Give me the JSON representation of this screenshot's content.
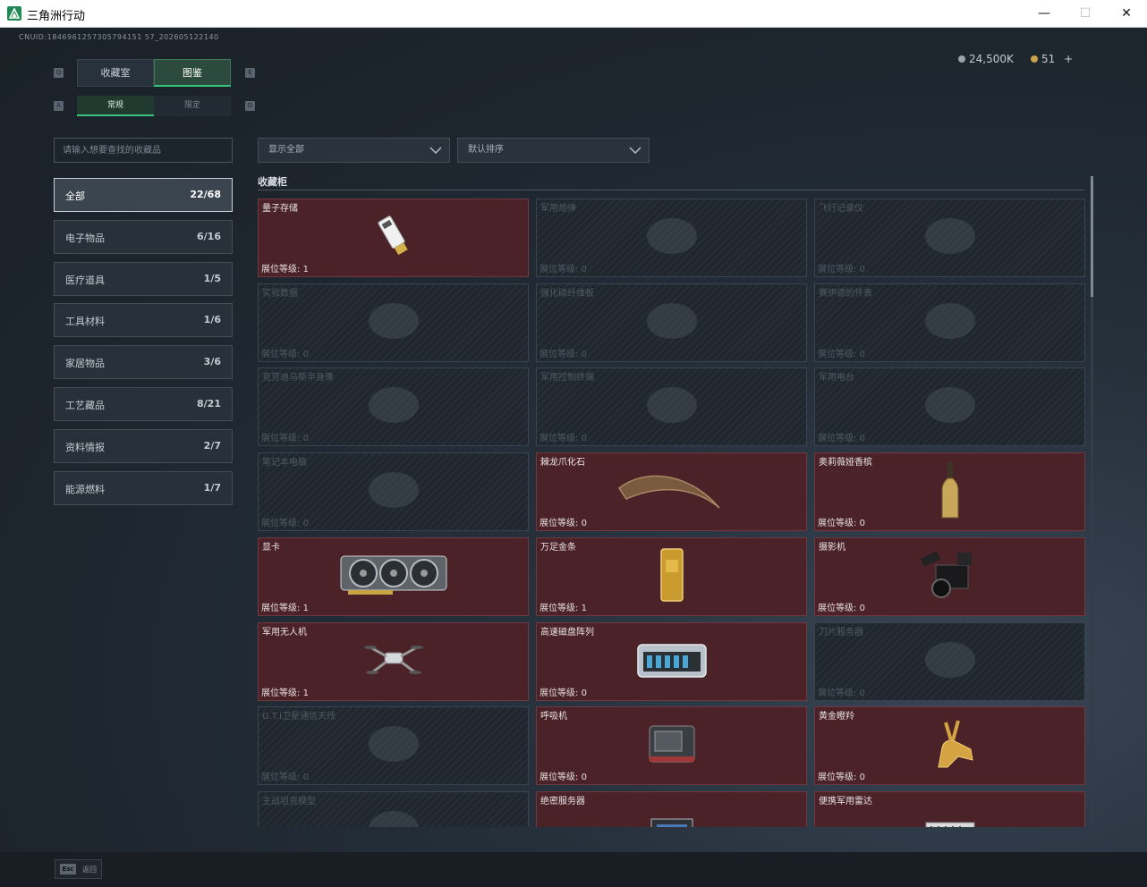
{
  "window": {
    "title": "三角洲行动",
    "minimize": "—",
    "maximize": "☐",
    "close": "✕"
  },
  "header": {
    "uid": "CNUID:1846961257305794151 57_202605122140",
    "currency_coins": "24,500K",
    "currency_gems": "51",
    "add": "+"
  },
  "tabs": [
    {
      "label": "收藏室",
      "active": false
    },
    {
      "label": "图鉴",
      "active": true
    }
  ],
  "tab_nav": {
    "prev": "Q",
    "next": "E"
  },
  "subtabs": [
    {
      "label": "常规",
      "active": true
    },
    {
      "label": "限定",
      "active": false
    }
  ],
  "subtab_nav": {
    "prev": "A",
    "next": "D"
  },
  "search": {
    "placeholder": "请输入想要查找的收藏品",
    "value": ""
  },
  "filters": {
    "display": "显示全部",
    "sort": "默认排序"
  },
  "categories": [
    {
      "label": "全部",
      "count": "22/68",
      "active": true
    },
    {
      "label": "电子物品",
      "count": "6/16"
    },
    {
      "label": "医疗道具",
      "count": "1/5"
    },
    {
      "label": "工具材料",
      "count": "1/6"
    },
    {
      "label": "家居物品",
      "count": "3/6"
    },
    {
      "label": "工艺藏品",
      "count": "8/21"
    },
    {
      "label": "资料情报",
      "count": "2/7"
    },
    {
      "label": "能源燃料",
      "count": "1/7"
    }
  ],
  "section_title": "收藏柜",
  "level_label": "展位等级:",
  "items": [
    {
      "name": "量子存储",
      "level": "1",
      "owned": true,
      "icon": "usb-drive-icon"
    },
    {
      "name": "军用炮弹",
      "level": "0",
      "owned": false,
      "icon": "shell-icon"
    },
    {
      "name": "飞行记录仪",
      "level": "0",
      "owned": false,
      "icon": "flight-recorder-icon"
    },
    {
      "name": "实验数据",
      "level": "0",
      "owned": false,
      "icon": "disc-icon"
    },
    {
      "name": "强化碳纤维板",
      "level": "0",
      "owned": false,
      "icon": "carbon-plate-icon"
    },
    {
      "name": "赛伊德的怀表",
      "level": "0",
      "owned": false,
      "icon": "pocket-watch-icon"
    },
    {
      "name": "克劳迪乌斯半身像",
      "level": "0",
      "owned": false,
      "icon": "bust-icon"
    },
    {
      "name": "军用控制终端",
      "level": "0",
      "owned": false,
      "icon": "terminal-icon"
    },
    {
      "name": "军用电台",
      "level": "0",
      "owned": false,
      "icon": "radio-icon"
    },
    {
      "name": "笔记本电脑",
      "level": "0",
      "owned": false,
      "icon": "laptop-icon"
    },
    {
      "name": "棘龙爪化石",
      "level": "0",
      "owned": true,
      "icon": "claw-fossil-icon"
    },
    {
      "name": "奥莉薇娅香槟",
      "level": "0",
      "owned": true,
      "icon": "champagne-icon"
    },
    {
      "name": "显卡",
      "level": "1",
      "owned": true,
      "icon": "graphics-card-icon"
    },
    {
      "name": "万足金条",
      "level": "1",
      "owned": true,
      "icon": "gold-bar-icon"
    },
    {
      "name": "摄影机",
      "level": "0",
      "owned": true,
      "icon": "camera-icon"
    },
    {
      "name": "军用无人机",
      "level": "1",
      "owned": true,
      "icon": "drone-icon"
    },
    {
      "name": "高速磁盘阵列",
      "level": "0",
      "owned": true,
      "icon": "disk-array-icon"
    },
    {
      "name": "刀片服务器",
      "level": "0",
      "owned": false,
      "icon": "blade-server-icon"
    },
    {
      "name": "G.T.I卫星通信天线",
      "level": "0",
      "owned": false,
      "icon": "satellite-dish-icon"
    },
    {
      "name": "呼吸机",
      "level": "0",
      "owned": true,
      "icon": "ventilator-icon"
    },
    {
      "name": "黄金瞪羚",
      "level": "0",
      "owned": true,
      "icon": "gold-gazelle-icon"
    },
    {
      "name": "主战坦克模型",
      "level": "",
      "owned": false,
      "icon": "tank-model-icon"
    },
    {
      "name": "绝密服务器",
      "level": "",
      "owned": true,
      "icon": "server-icon"
    },
    {
      "name": "便携军用雷达",
      "level": "",
      "owned": true,
      "icon": "radar-icon"
    }
  ],
  "footer": {
    "esc_key": "Esc",
    "esc_label": "返回"
  },
  "colors": {
    "accent": "#39c47e",
    "owned_card": "#4a2227",
    "locked_card": "#242c34"
  },
  "scroll": {
    "position": 0.0,
    "visible_fraction": 0.185
  }
}
